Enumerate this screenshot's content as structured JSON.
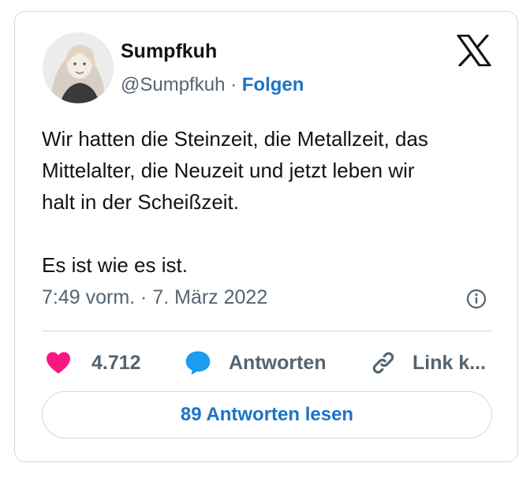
{
  "author": {
    "name": "Sumpfkuh",
    "handle": "@Sumpfkuh",
    "separator": " · ",
    "follow_label": "Folgen"
  },
  "tweet": {
    "lines": [
      "Wir hatten die Steinzeit, die Metallzeit, das",
      "Mittelalter, die Neuzeit und jetzt leben wir",
      "halt in der Scheißzeit.",
      "Es ist wie es ist."
    ],
    "timestamp": "7:49 vorm. · 7. März 2022"
  },
  "actions": {
    "like_count": "4.712",
    "reply_label": "Antworten",
    "link_label": "Link k..."
  },
  "read_replies_label": "89 Antworten lesen",
  "icons": [
    "x-logo-icon",
    "info-icon",
    "heart-icon",
    "reply-bubble-icon",
    "link-icon"
  ],
  "colors": {
    "accent": "#1d73c8",
    "like": "#f91880",
    "reply": "#1d9bf0",
    "secondary_text": "#536471",
    "border": "#cfd9de"
  }
}
